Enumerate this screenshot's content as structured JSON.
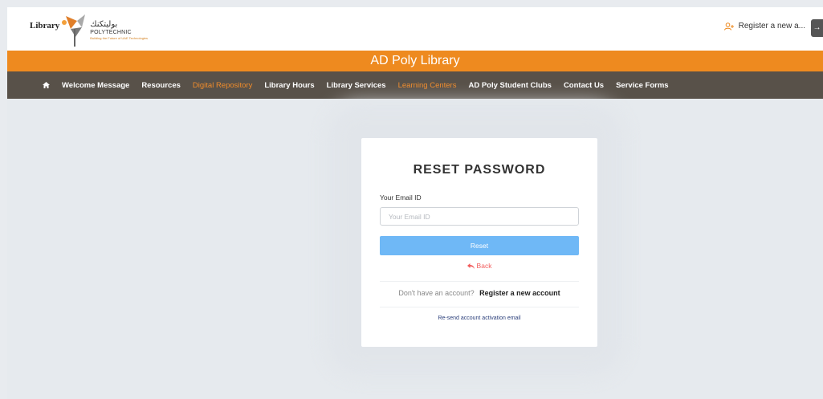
{
  "header": {
    "logo_word": "Library",
    "logo_arabic": "بوليتكنك",
    "logo_english": "POLYTECHNIC",
    "logo_tagline": "Building the Future of UAE Technologies",
    "register_label": "Register a new a...",
    "enter_icon": "login-arrow-icon"
  },
  "site_title": "AD Poly Library",
  "nav": {
    "items": [
      {
        "label": "Welcome Message"
      },
      {
        "label": "Resources"
      },
      {
        "label": "Digital Repository"
      },
      {
        "label": "Library Hours"
      },
      {
        "label": "Library Services"
      },
      {
        "label": "Learning Centers"
      },
      {
        "label": "AD Poly Student Clubs"
      },
      {
        "label": "Contact Us"
      },
      {
        "label": "Service Forms"
      }
    ]
  },
  "form": {
    "title": "RESET PASSWORD",
    "email_label": "Your Email ID",
    "email_placeholder": "Your Email ID",
    "email_value": "",
    "reset_label": "Reset",
    "back_label": "Back",
    "no_account_text": "Don't have an account?",
    "register_link": "Register a new account",
    "resend_link": "Re-send account activation email"
  },
  "colors": {
    "orange": "#ee8a1f",
    "nav_bg": "#585149",
    "button_blue": "#6fb8f6",
    "back_red": "#f25c5c",
    "page_bg": "#e6eaee"
  }
}
